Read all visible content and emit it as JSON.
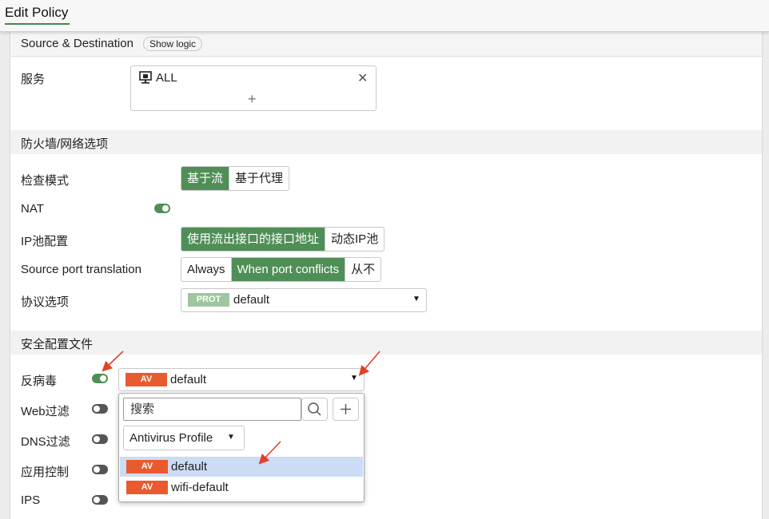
{
  "header": {
    "title": "Edit Policy"
  },
  "source_destination": {
    "label": "Source & Destination",
    "show_logic": "Show logic"
  },
  "service": {
    "label": "服务",
    "value": "ALL",
    "remove": "✕",
    "add": "+"
  },
  "firewall": {
    "title": "防火墙/网络选项",
    "inspection_mode": {
      "label": "检查模式",
      "options": [
        "基于流",
        "基于代理"
      ],
      "active": 0
    },
    "nat": {
      "label": "NAT",
      "enabled": true
    },
    "ip_pool": {
      "label": "IP池配置",
      "options": [
        "使用流出接口的接口地址",
        "动态IP池"
      ],
      "active": 0
    },
    "source_port": {
      "label": "Source port translation",
      "options": [
        "Always",
        "When port conflicts",
        "从不"
      ],
      "active": 1
    },
    "protocol": {
      "label": "协议选项",
      "tag": "PROT",
      "value": "default"
    }
  },
  "security_profiles": {
    "title": "安全配置文件",
    "antivirus": {
      "label": "反病毒",
      "enabled": true,
      "tag": "AV",
      "value": "default"
    },
    "web_filter": {
      "label": "Web过滤",
      "enabled": false
    },
    "dns_filter": {
      "label": "DNS过滤",
      "enabled": false
    },
    "app_control": {
      "label": "应用控制",
      "enabled": false
    },
    "ips": {
      "label": "IPS",
      "enabled": false
    }
  },
  "dropdown": {
    "search_placeholder": "搜索",
    "filter_label": "Antivirus Profile",
    "items": [
      {
        "tag": "AV",
        "label": "default",
        "selected": true
      },
      {
        "tag": "AV",
        "label": "wifi-default",
        "selected": false
      }
    ]
  },
  "colors": {
    "accent": "#4f8f57",
    "av_tag": "#ea5a2f",
    "prot_tag": "#9fc69f",
    "selection": "#ccdcf5",
    "annotation_arrow": "#e0412b"
  }
}
